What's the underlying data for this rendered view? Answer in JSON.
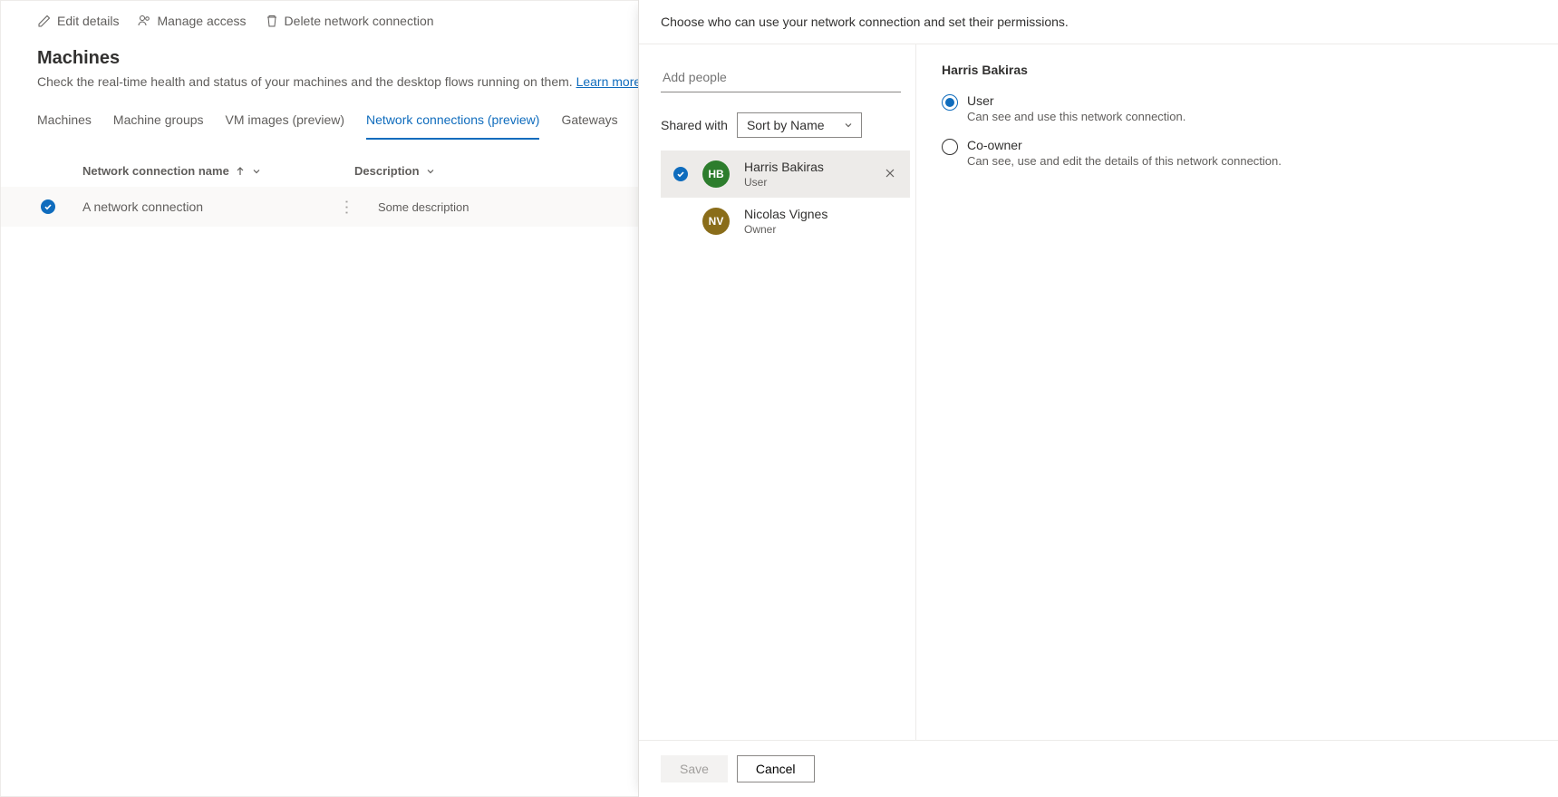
{
  "commands": {
    "edit": "Edit details",
    "manage": "Manage access",
    "delete": "Delete network connection"
  },
  "page": {
    "title": "Machines",
    "subtitle": "Check the real-time health and status of your machines and the desktop flows running on them.",
    "learn_more": "Learn more"
  },
  "tabs": [
    "Machines",
    "Machine groups",
    "VM images (preview)",
    "Network connections (preview)",
    "Gateways"
  ],
  "active_tab_index": 3,
  "grid": {
    "columns": {
      "name": "Network connection name",
      "desc": "Description"
    },
    "row": {
      "name": "A network connection",
      "desc": "Some description"
    }
  },
  "panel": {
    "header": "Choose who can use your network connection and set their permissions.",
    "add_people_placeholder": "Add people",
    "shared_with_label": "Shared with",
    "sort_value": "Sort by Name",
    "people": [
      {
        "name": "Harris Bakiras",
        "role": "User",
        "initials": "HB",
        "color": "#2d7d2d",
        "selected": true,
        "removable": true
      },
      {
        "name": "Nicolas Vignes",
        "role": "Owner",
        "initials": "NV",
        "color": "#8a6d1a",
        "selected": false,
        "removable": false
      }
    ],
    "permissions": {
      "heading": "Harris Bakiras",
      "options": [
        {
          "label": "User",
          "desc": "Can see and use this network connection.",
          "selected": true
        },
        {
          "label": "Co-owner",
          "desc": "Can see, use and edit the details of this network connection.",
          "selected": false
        }
      ]
    },
    "footer": {
      "save": "Save",
      "cancel": "Cancel"
    }
  }
}
